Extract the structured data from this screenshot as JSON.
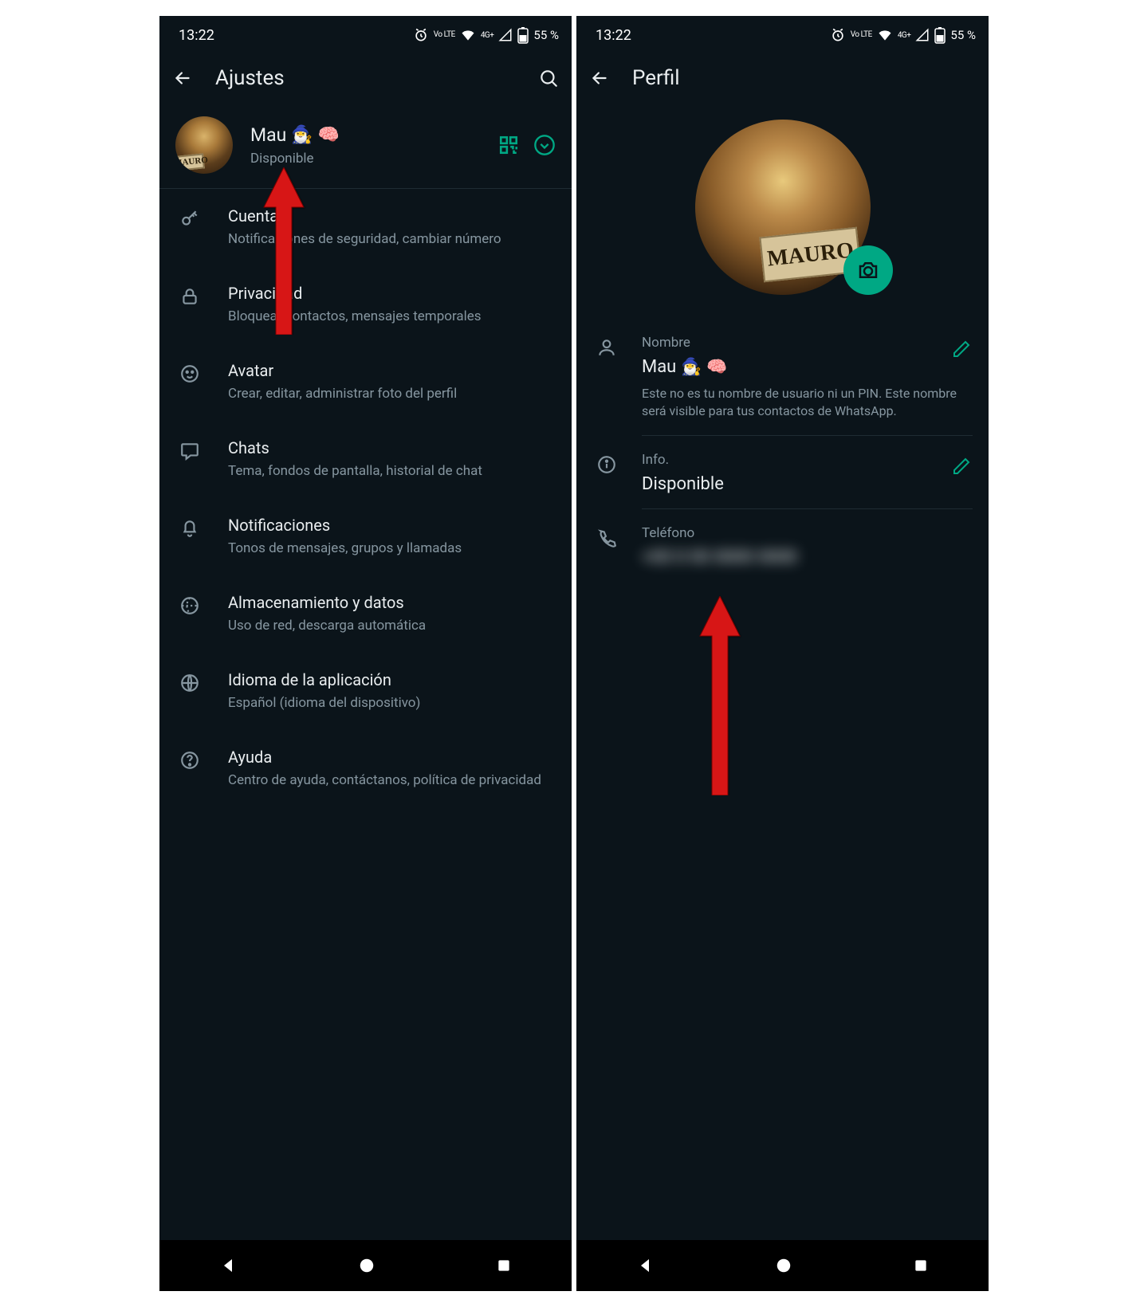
{
  "status": {
    "time": "13:22",
    "volte": "Vo LTE",
    "net": "4G+",
    "battery": "55 %"
  },
  "left": {
    "title": "Ajustes",
    "profile": {
      "name": "Mau",
      "emoji1": "🧙‍♂️",
      "emoji2": "🧠",
      "status": "Disponible",
      "sign": "MAURO"
    },
    "items": [
      {
        "icon": "key",
        "label": "Cuenta",
        "sub": "Notificaciones de seguridad, cambiar número"
      },
      {
        "icon": "lock",
        "label": "Privacidad",
        "sub": "Bloquear contactos, mensajes temporales"
      },
      {
        "icon": "face",
        "label": "Avatar",
        "sub": "Crear, editar, administrar foto del perfil"
      },
      {
        "icon": "chat",
        "label": "Chats",
        "sub": "Tema, fondos de pantalla, historial de chat"
      },
      {
        "icon": "bell",
        "label": "Notificaciones",
        "sub": "Tonos de mensajes, grupos y llamadas"
      },
      {
        "icon": "data",
        "label": "Almacenamiento y datos",
        "sub": "Uso de red, descarga automática"
      },
      {
        "icon": "globe",
        "label": "Idioma de la aplicación",
        "sub": "Español (idioma del dispositivo)"
      },
      {
        "icon": "help",
        "label": "Ayuda",
        "sub": "Centro de ayuda, contáctanos, política de privacidad"
      }
    ]
  },
  "right": {
    "title": "Perfil",
    "sign": "MAURO",
    "name_field": {
      "head": "Nombre",
      "value": "Mau",
      "emoji1": "🧙‍♂️",
      "emoji2": "🧠",
      "hint": "Este no es tu nombre de usuario ni un PIN. Este nombre será visible para tus contactos de WhatsApp."
    },
    "info_field": {
      "head": "Info.",
      "value": "Disponible"
    },
    "phone_field": {
      "head": "Teléfono",
      "value": "+00 0 00 0000 0000"
    }
  }
}
